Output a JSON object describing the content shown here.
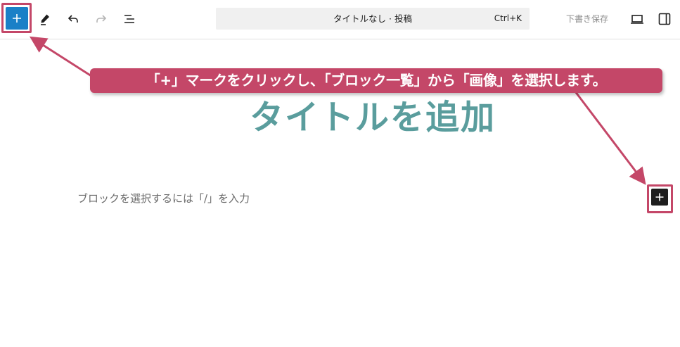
{
  "toolbar": {
    "inserter_icon": "plus-icon",
    "tools": [
      {
        "name": "pencil-icon",
        "enabled": true
      },
      {
        "name": "undo-icon",
        "enabled": true
      },
      {
        "name": "redo-icon",
        "enabled": false
      },
      {
        "name": "list-view-icon",
        "enabled": true
      }
    ],
    "command_bar": {
      "title": "タイトルなし · 投稿",
      "shortcut": "Ctrl+K"
    },
    "save_draft_label": "下書き保存",
    "preview_icon": "laptop-icon",
    "settings_icon": "sidebar-icon"
  },
  "annotation": {
    "text": "「+」マークをクリックし、「ブロック一覧」から「画像」を選択します。"
  },
  "editor": {
    "title_placeholder": "タイトルを追加",
    "block_placeholder": "ブロックを選択するには「/」を入力",
    "add_block_icon": "plus-icon"
  },
  "colors": {
    "accent": "#c44768",
    "inserter_blue": "#1a80c7",
    "title_teal": "#5a9d9d"
  }
}
